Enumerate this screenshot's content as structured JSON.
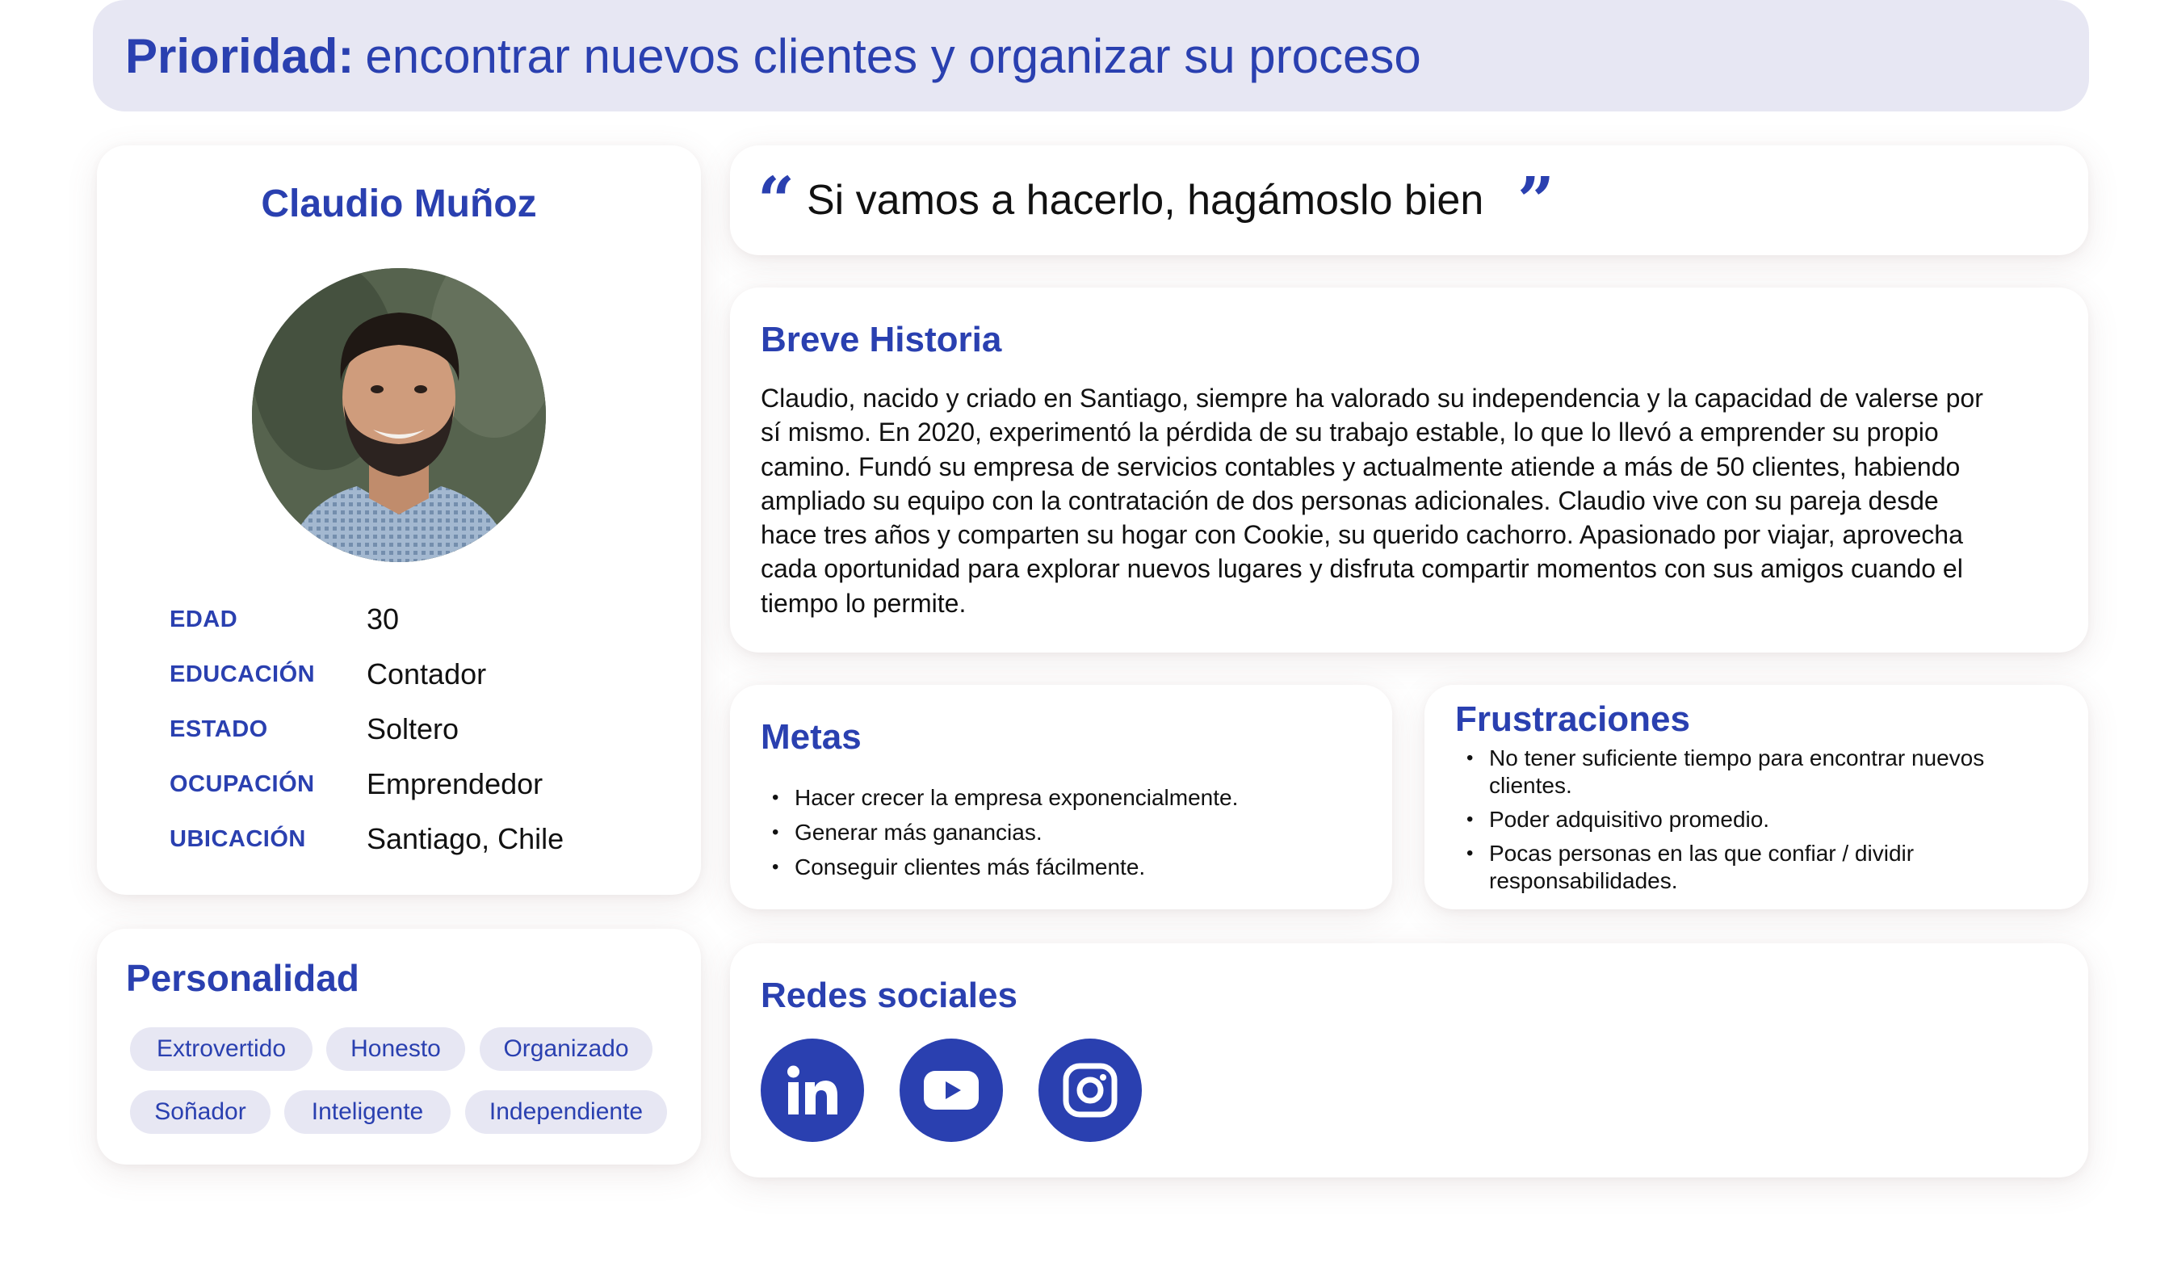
{
  "priority": {
    "label": "Prioridad:",
    "text": "encontrar nuevos clientes y organizar su proceso"
  },
  "profile": {
    "name": "Claudio Muñoz",
    "attributes": [
      {
        "key": "EDAD",
        "value": "30"
      },
      {
        "key": "EDUCACIÓN",
        "value": "Contador"
      },
      {
        "key": "ESTADO",
        "value": "Soltero"
      },
      {
        "key": "OCUPACIÓN",
        "value": "Emprendedor"
      },
      {
        "key": "UBICACIÓN",
        "value": "Santiago, Chile"
      }
    ]
  },
  "personality": {
    "title": "Personalidad",
    "traits": [
      "Extrovertido",
      "Honesto",
      "Organizado",
      "Soñador",
      "Inteligente",
      "Independiente"
    ]
  },
  "quote": {
    "open_mark": "“",
    "text": "Si vamos a hacerlo, hagámoslo bien",
    "close_mark": "”"
  },
  "history": {
    "title": "Breve Historia",
    "lines": [
      "Claudio, nacido y criado en Santiago, siempre ha valorado su independencia y la capacidad de valerse por",
      "sí mismo. En 2020, experimentó la pérdida de su trabajo estable, lo que lo llevó a emprender su propio",
      "camino. Fundó su empresa de servicios contables y actualmente atiende a más de 50 clientes, habiendo",
      "ampliado su equipo con la contratación de dos personas adicionales. Claudio vive con su pareja desde",
      "hace tres años y comparten su hogar con Cookie, su querido cachorro. Apasionado por viajar, aprovecha",
      "cada oportunidad para explorar nuevos lugares y disfruta compartir momentos con sus amigos cuando el",
      "tiempo lo permite."
    ]
  },
  "goals": {
    "title": "Metas",
    "items": [
      "Hacer crecer la empresa exponencialmente.",
      "Generar más ganancias.",
      "Conseguir clientes más fácilmente."
    ]
  },
  "frustrations": {
    "title": "Frustraciones",
    "items": [
      [
        "No tener suficiente tiempo para encontrar nuevos",
        "clientes."
      ],
      [
        "Poder adquisitivo promedio."
      ],
      [
        "Pocas personas en las que confiar / dividir",
        "responsabilidades."
      ]
    ]
  },
  "social": {
    "title": "Redes sociales",
    "networks": [
      "linkedin-icon",
      "youtube-icon",
      "instagram-icon"
    ]
  },
  "colors": {
    "accent": "#2a40b0",
    "chip_bg": "#e7e7f3",
    "banner_bg": "#e7e7f3"
  }
}
